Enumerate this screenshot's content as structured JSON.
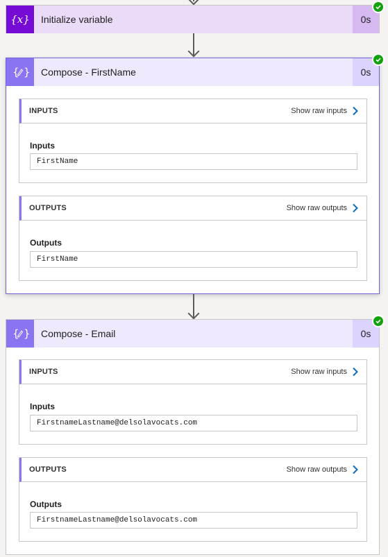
{
  "steps": [
    {
      "title": "Initialize variable",
      "duration": "0s",
      "icon": "variable-icon",
      "status": "succeeded"
    },
    {
      "title": "Compose - FirstName",
      "duration": "0s",
      "icon": "compose-icon",
      "status": "succeeded",
      "inputs": {
        "header": "INPUTS",
        "show_raw_label": "Show raw inputs",
        "field_label": "Inputs",
        "value": "FirstName"
      },
      "outputs": {
        "header": "OUTPUTS",
        "show_raw_label": "Show raw outputs",
        "field_label": "Outputs",
        "value": "FirstName"
      }
    },
    {
      "title": "Compose - Email",
      "duration": "0s",
      "icon": "compose-icon",
      "status": "succeeded",
      "inputs": {
        "header": "INPUTS",
        "show_raw_label": "Show raw inputs",
        "field_label": "Inputs",
        "value": "FirstnameLastname@delsolavocats.com"
      },
      "outputs": {
        "header": "OUTPUTS",
        "show_raw_label": "Show raw outputs",
        "field_label": "Outputs",
        "value": "FirstnameLastname@delsolavocats.com"
      }
    }
  ],
  "colors": {
    "variable_accent": "#770bd6",
    "compose_accent": "#8b74f1",
    "success": "#13a10e",
    "link_chevron": "#0f6cbd"
  }
}
